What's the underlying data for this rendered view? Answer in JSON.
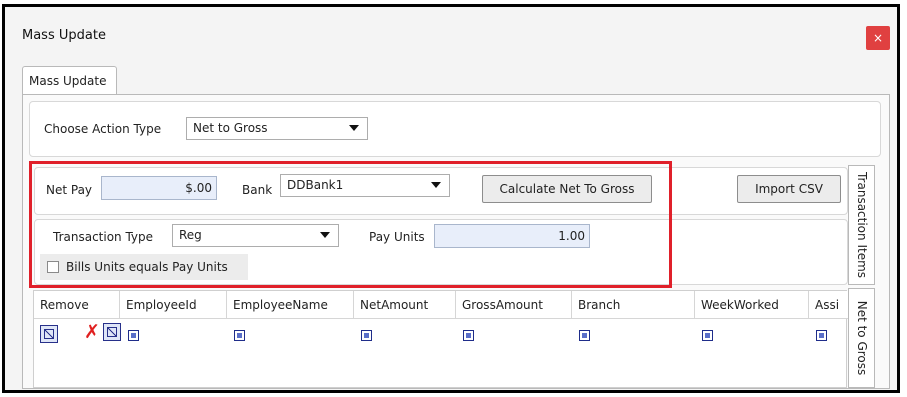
{
  "window": {
    "title": "Mass Update",
    "close_glyph": "×"
  },
  "tabs": {
    "main": "Mass Update"
  },
  "action": {
    "label": "Choose Action Type",
    "value": "Net to Gross"
  },
  "form": {
    "net_pay_label": "Net Pay",
    "net_pay_value": "$.00",
    "bank_label": "Bank",
    "bank_value": "DDBank1",
    "calculate_button": "Calculate Net To Gross",
    "import_button": "Import CSV",
    "transaction_type_label": "Transaction Type",
    "transaction_type_value": "Reg",
    "pay_units_label": "Pay Units",
    "pay_units_value": "1.00",
    "bills_units_label": "Bills Units equals Pay Units",
    "bills_units_checked": false
  },
  "side_tabs": {
    "transaction_items": "Transaction Items",
    "net_to_gross": "Net to Gross"
  },
  "grid": {
    "columns": [
      "Remove",
      "EmployeeId",
      "EmployeeName",
      "NetAmount",
      "GrossAmount",
      "Branch",
      "WeekWorked",
      "Assi"
    ]
  },
  "colors": {
    "highlight_box": "#e0202a",
    "close_button": "#e04040",
    "input_fill": "#e8eefa"
  }
}
